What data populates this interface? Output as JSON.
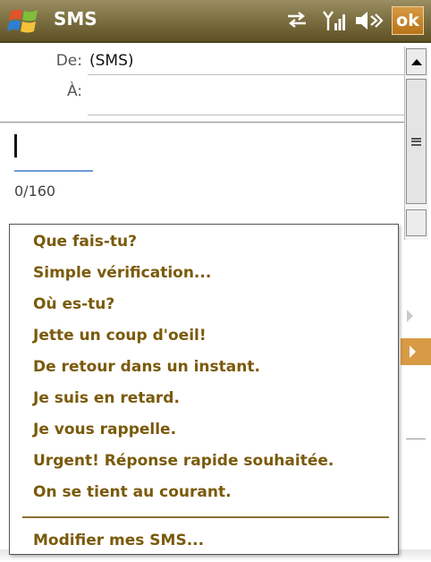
{
  "titlebar": {
    "app_title": "SMS",
    "ok_label": "ok",
    "icons": [
      "windows-start-icon",
      "sync-arrows-icon",
      "signal-strength-icon",
      "speaker-volume-icon"
    ]
  },
  "message": {
    "from_label": "De:",
    "from_value": "(SMS)",
    "to_label": "À:",
    "to_value": "",
    "body": "",
    "char_count": "0/160"
  },
  "menu": {
    "items": [
      "Que fais-tu?",
      "Simple vérification...",
      "Où es-tu?",
      "Jette un coup d'oeil!",
      "De retour dans un instant.",
      "Je suis en retard.",
      "Je vous rappelle.",
      "Urgent! Réponse rapide souhaitée.",
      "On se tient au courant."
    ],
    "footer_item": "Modifier mes SMS..."
  },
  "colors": {
    "titlebar": "#7e7143",
    "accent_orange": "#d89a44",
    "menu_text": "#7a5a0a",
    "compose_underline": "#6c9bd2"
  }
}
